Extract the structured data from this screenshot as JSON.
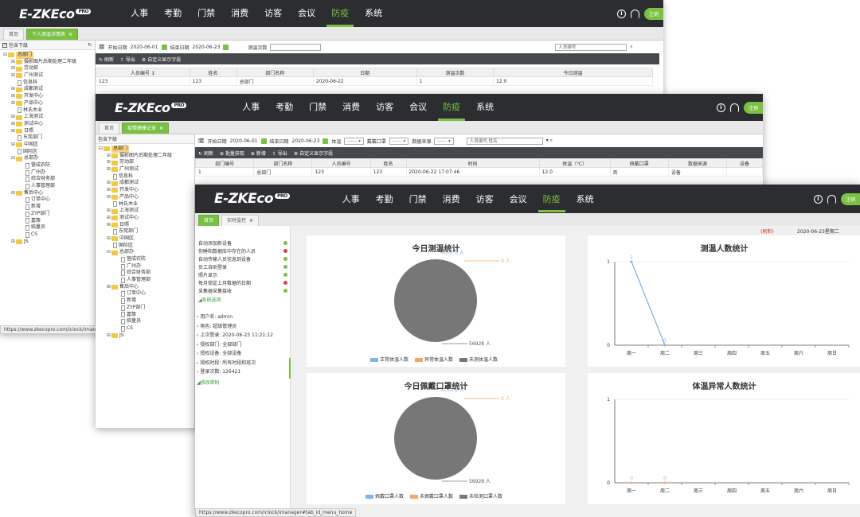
{
  "brand": {
    "logo": "E-ZKEco",
    "pro": "PRO"
  },
  "nav": [
    "人事",
    "考勤",
    "门禁",
    "消费",
    "访客",
    "会议",
    "防疫",
    "系统"
  ],
  "nav_active_index": 6,
  "logout_label": "注销",
  "accent_color": "#7ac143",
  "home_tab": "首页",
  "dept_header": "包含下级",
  "tree": [
    {
      "label": "总部门",
      "level": 0,
      "type": "folder",
      "pm": "⊟"
    },
    {
      "label": "摄影图片后期处理二年级",
      "level": 1,
      "type": "folder",
      "pm": "⊞"
    },
    {
      "label": "劳动部",
      "level": 1,
      "type": "folder",
      "pm": "⊞"
    },
    {
      "label": "广州测试",
      "level": 1,
      "type": "folder",
      "pm": "⊞"
    },
    {
      "label": "信息科",
      "level": 1,
      "type": "file",
      "pm": ""
    },
    {
      "label": "成都测试",
      "level": 1,
      "type": "folder",
      "pm": "⊞"
    },
    {
      "label": "开发中心",
      "level": 1,
      "type": "folder",
      "pm": "⊞"
    },
    {
      "label": "产品中心",
      "level": 1,
      "type": "folder",
      "pm": "⊞"
    },
    {
      "label": "林氏木业",
      "level": 1,
      "type": "file",
      "pm": ""
    },
    {
      "label": "上海测试",
      "level": 1,
      "type": "folder",
      "pm": "⊞"
    },
    {
      "label": "测试中心",
      "level": 1,
      "type": "folder",
      "pm": "⊞"
    },
    {
      "label": "日照",
      "level": 1,
      "type": "folder",
      "pm": "⊞"
    },
    {
      "label": "东莞部门",
      "level": 1,
      "type": "file",
      "pm": ""
    },
    {
      "label": "中国区",
      "level": 1,
      "type": "folder",
      "pm": "⊞"
    },
    {
      "label": "国际区",
      "level": 1,
      "type": "file",
      "pm": ""
    },
    {
      "label": "总部办",
      "level": 1,
      "type": "folder",
      "pm": "⊟"
    },
    {
      "label": "营成农防",
      "level": 2,
      "type": "file",
      "pm": ""
    },
    {
      "label": "广州办",
      "level": 2,
      "type": "file",
      "pm": ""
    },
    {
      "label": "综合财务部",
      "level": 2,
      "type": "file",
      "pm": ""
    },
    {
      "label": "人事管理部",
      "level": 2,
      "type": "file",
      "pm": ""
    },
    {
      "label": "售后中心",
      "level": 1,
      "type": "folder",
      "pm": "⊞"
    },
    {
      "label": "订单中心",
      "level": 2,
      "type": "file",
      "pm": ""
    },
    {
      "label": "新增",
      "level": 2,
      "type": "file",
      "pm": ""
    },
    {
      "label": "ZYP部门",
      "level": 2,
      "type": "file",
      "pm": ""
    },
    {
      "label": "嘉策",
      "level": 2,
      "type": "file",
      "pm": ""
    },
    {
      "label": "临量员",
      "level": 2,
      "type": "file",
      "pm": ""
    },
    {
      "label": "CS",
      "level": 2,
      "type": "file",
      "pm": ""
    },
    {
      "label": "JS",
      "level": 1,
      "type": "folder",
      "pm": "⊞"
    }
  ],
  "w1": {
    "tab": "个人测温详情表",
    "start_label": "开始日期",
    "start_value": "2020-06-01",
    "end_label": "结束日期",
    "end_value": "2020-06-23",
    "count_label": "测温次数",
    "search_placeholder": "人员编号",
    "tools": [
      "刷新",
      "导出",
      "自定义显示字段"
    ],
    "columns": [
      "人员编号 ↕",
      "姓名",
      "部门名称",
      "日期",
      "测温次数",
      "今日测温"
    ],
    "rows": [
      [
        "123",
        "123",
        "总部门",
        "2020-06-22",
        "1",
        "12.0"
      ]
    ],
    "url": "https://www.zkecopro.com/iclock/imanager"
  },
  "w2": {
    "tab": "疫情健康记录",
    "start_label": "开始日期",
    "start_value": "2020-06-01",
    "end_label": "结束日期",
    "end_value": "2020-06-23",
    "temp_label": "体温",
    "mask_label": "戴戴口罩",
    "source_label": "数据来源",
    "select_value": "------",
    "search_placeholder": "人员编号,姓名",
    "tools": [
      "刷新",
      "批量获取",
      "新增",
      "导出",
      "自定义显示字段"
    ],
    "columns": [
      "部门编号",
      "部门名称",
      "人员编号",
      "姓名",
      "时间",
      "体温（℃）",
      "佩戴口罩",
      "数据来源",
      "设备"
    ],
    "rows": [
      [
        "1",
        "总部门",
        "123",
        "123",
        "2020-06-22 17:07:46",
        "12.0",
        "否",
        "设备",
        ""
      ]
    ]
  },
  "w3": {
    "tab": "实时监控",
    "note": "(刷新)",
    "date": "2020-06-23星期二",
    "tasks": [
      {
        "label": "自动添加新设备",
        "status": "green"
      },
      {
        "label": "你睡和数据库中存在的人员",
        "status": "red"
      },
      {
        "label": "自动传输人员信息到设备",
        "status": "green"
      },
      {
        "label": "员工自助登录",
        "status": "green"
      },
      {
        "label": "照片显示",
        "status": "green"
      },
      {
        "label": "每月锁定上月数据的日期",
        "status": "red"
      },
      {
        "label": "采集器采集接收",
        "status": "green"
      }
    ],
    "sys_link": "系统选项",
    "info": [
      "用户名: admin",
      "角色: 超级管理员",
      "上次登录: 2020-06-23 11:21:12",
      "授权部门: 全部部门",
      "授权设备: 全部设备",
      "授权时段: 所有时段和班次",
      "登录次数: 126421"
    ],
    "pwd_link": "修改密码",
    "url": "https://www.zkecopro.com/iclock/imanager#tab_id_menu_home"
  },
  "chart_data": [
    {
      "type": "pie",
      "title": "今日测温统计",
      "labels": [
        "正常体温人数",
        "异常体温人数",
        "未测体温人数"
      ],
      "values": [
        0,
        0,
        56928
      ],
      "value_labels": [
        "0 人",
        "0 人",
        "56928 人"
      ],
      "colors": [
        "#7fb5e6",
        "#f4a66a",
        "#777777"
      ]
    },
    {
      "type": "line",
      "title": "测温人数统计",
      "categories": [
        "周一",
        "周二",
        "周三",
        "周四",
        "周五",
        "周六",
        "周日"
      ],
      "values": [
        1,
        0
      ],
      "ylim": [
        0,
        1
      ],
      "y_ticks": [
        "0",
        "1"
      ],
      "color": "#7fb5e6"
    },
    {
      "type": "pie",
      "title": "今日佩戴口罩统计",
      "labels": [
        "佩戴口罩人数",
        "未佩戴口罩人数",
        "未检测口罩人数"
      ],
      "values": [
        0,
        0,
        56928
      ],
      "value_labels": [
        "0 人",
        "0 人",
        "56928 人"
      ],
      "colors": [
        "#7fb5e6",
        "#f4a66a",
        "#777777"
      ]
    },
    {
      "type": "line",
      "title": "体温异常人数统计",
      "categories": [
        "周一",
        "周二",
        "周三",
        "周四",
        "周五",
        "周六",
        "周日"
      ],
      "values": [
        0,
        0
      ],
      "ylim": [
        0,
        1
      ],
      "y_ticks": [
        "0",
        "1"
      ],
      "color": "#f4a66a"
    }
  ]
}
